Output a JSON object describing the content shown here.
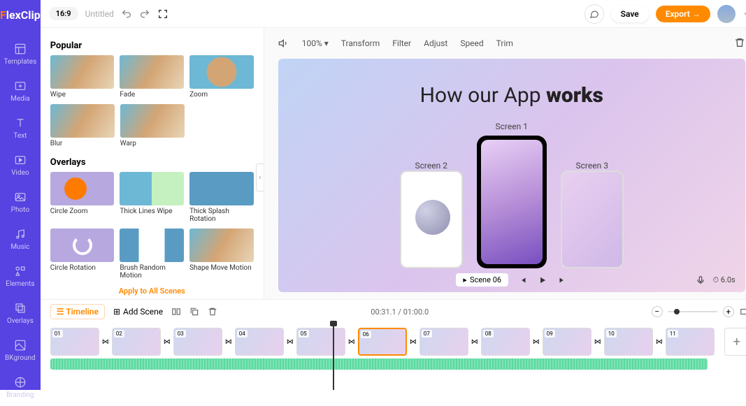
{
  "logo": {
    "text": "FlexClip"
  },
  "nav": [
    {
      "label": "Templates"
    },
    {
      "label": "Media"
    },
    {
      "label": "Text"
    },
    {
      "label": "Video"
    },
    {
      "label": "Photo"
    },
    {
      "label": "Music"
    },
    {
      "label": "Elements"
    },
    {
      "label": "Overlays"
    },
    {
      "label": "BKground"
    },
    {
      "label": "Branding"
    }
  ],
  "topbar": {
    "ratio": "16:9",
    "title": "Untitled",
    "save": "Save",
    "export": "Export →"
  },
  "panel": {
    "section1": "Popular",
    "section2": "Overlays",
    "popular": [
      {
        "label": "Wipe"
      },
      {
        "label": "Fade"
      },
      {
        "label": "Zoom"
      },
      {
        "label": "Blur"
      },
      {
        "label": "Warp"
      }
    ],
    "overlays": [
      {
        "label": "Circle Zoom"
      },
      {
        "label": "Thick Lines Wipe"
      },
      {
        "label": "Thick Splash Rotation"
      },
      {
        "label": "Circle Rotation"
      },
      {
        "label": "Brush Random Motion"
      },
      {
        "label": "Shape Move Motion"
      }
    ],
    "apply": "Apply to All Scenes"
  },
  "toolbar": {
    "zoom": "100%",
    "items": [
      "Transform",
      "Filter",
      "Adjust",
      "Speed",
      "Trim"
    ]
  },
  "preview": {
    "title_a": "How our App ",
    "title_b": "works",
    "screen1": "Screen 1",
    "screen2": "Screen 2",
    "screen3": "Screen 3",
    "scene": "Scene 06",
    "duration": "6.0s"
  },
  "timeline": {
    "label": "Timeline",
    "add": "Add Scene",
    "time": "00:31.1 / 01:00.0",
    "clips": [
      "01",
      "02",
      "03",
      "04",
      "05",
      "06",
      "07",
      "08",
      "09",
      "10",
      "11"
    ]
  }
}
